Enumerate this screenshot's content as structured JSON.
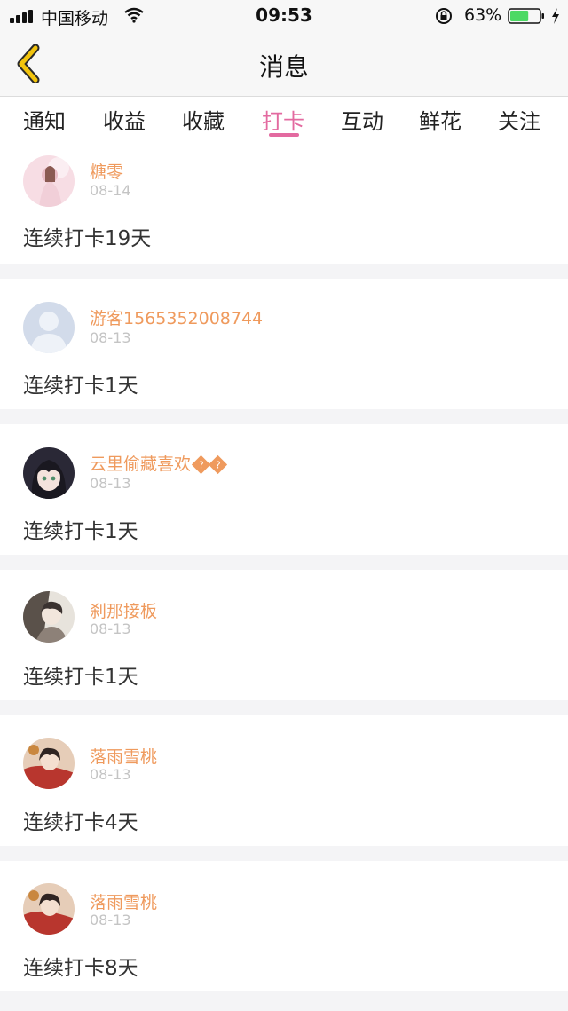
{
  "status_bar": {
    "carrier": "中国移动",
    "time": "09:53",
    "battery_pct": "63%",
    "battery_level": 0.63
  },
  "header": {
    "title": "消息",
    "back_icon": "chevron-left-icon",
    "accent": "#f2c40d"
  },
  "tabs": [
    {
      "label": "通知"
    },
    {
      "label": "收益"
    },
    {
      "label": "收藏"
    },
    {
      "label": "打卡",
      "active": true
    },
    {
      "label": "互动"
    },
    {
      "label": "鲜花"
    },
    {
      "label": "关注"
    }
  ],
  "colors": {
    "tab_active": "#e36aa0",
    "username": "#ef9a5d",
    "date": "#c4c4c4"
  },
  "messages": [
    {
      "name": "糖零",
      "date": "08-14",
      "text": "连续打卡19天"
    },
    {
      "name": "游客1565352008744",
      "date": "08-13",
      "text": "连续打卡1天"
    },
    {
      "name": "云里偷藏喜欢",
      "date": "08-13",
      "text": "连续打卡1天"
    },
    {
      "name": "刹那接板",
      "date": "08-13",
      "text": "连续打卡1天"
    },
    {
      "name": "落雨雪桃",
      "date": "08-13",
      "text": "连续打卡4天"
    },
    {
      "name": "落雨雪桃",
      "date": "08-13",
      "text": "连续打卡8天"
    }
  ]
}
